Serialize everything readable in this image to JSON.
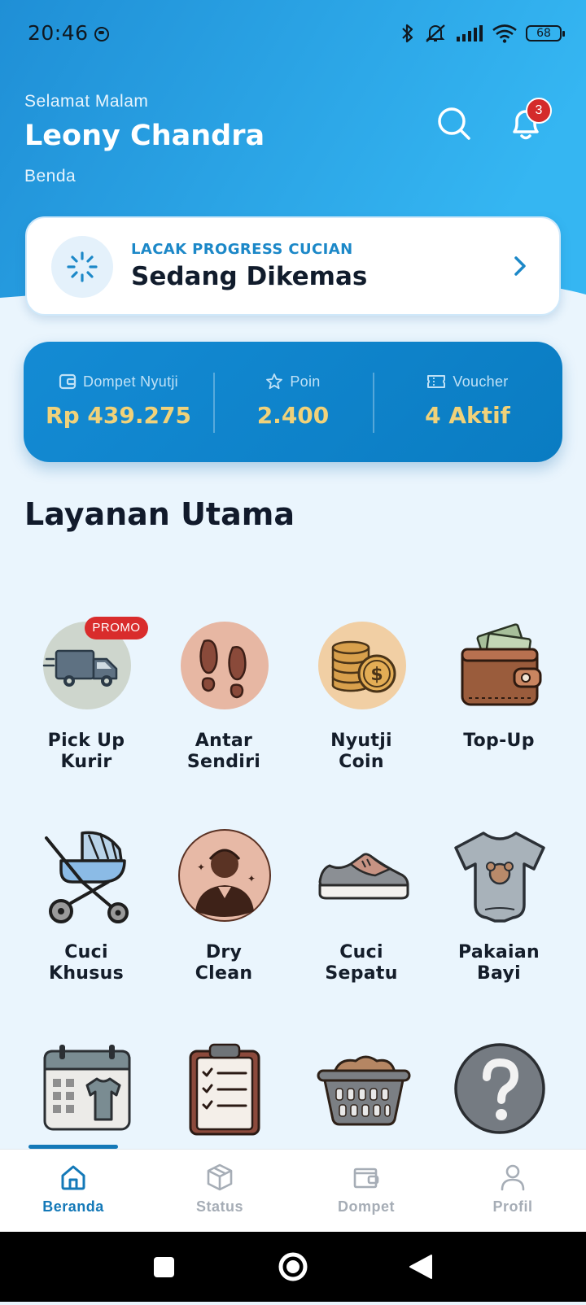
{
  "status_bar": {
    "time": "20:46",
    "battery": "68"
  },
  "header": {
    "greeting": "Selamat Malam",
    "user_name": "Leony Chandra",
    "location": "Benda",
    "notification_count": "3"
  },
  "tracking": {
    "label": "LACAK PROGRESS CUCIAN",
    "status": "Sedang Dikemas"
  },
  "wallet": {
    "items": [
      {
        "label": "Dompet Nyutji",
        "value": "Rp 439.275",
        "icon": "wallet-icon"
      },
      {
        "label": "Poin",
        "value": "2.400",
        "icon": "star-icon"
      },
      {
        "label": "Voucher",
        "value": "4 Aktif",
        "icon": "ticket-icon"
      }
    ]
  },
  "services": {
    "title": "Layanan Utama",
    "promo_badge": "PROMO",
    "items": [
      {
        "label": "Pick Up\nKurir",
        "icon": "delivery-truck-icon"
      },
      {
        "label": "Antar\nSendiri",
        "icon": "footprints-icon"
      },
      {
        "label": "Nyutji\nCoin",
        "icon": "coins-icon"
      },
      {
        "label": "Top-Up",
        "icon": "wallet-icon"
      },
      {
        "label": "Cuci\nKhusus",
        "icon": "baby-stroller-icon"
      },
      {
        "label": "Dry\nClean",
        "icon": "person-icon"
      },
      {
        "label": "Cuci\nSepatu",
        "icon": "sneaker-icon"
      },
      {
        "label": "Pakaian\nBayi",
        "icon": "baby-onesie-icon"
      },
      {
        "label": "",
        "icon": "calendar-shirt-icon"
      },
      {
        "label": "",
        "icon": "clipboard-checklist-icon"
      },
      {
        "label": "",
        "icon": "laundry-basket-icon"
      },
      {
        "label": "",
        "icon": "question-icon"
      }
    ]
  },
  "bottom_nav": {
    "items": [
      {
        "label": "Beranda",
        "icon": "home-icon",
        "active": true
      },
      {
        "label": "Status",
        "icon": "package-icon",
        "active": false
      },
      {
        "label": "Dompet",
        "icon": "wallet-icon",
        "active": false
      },
      {
        "label": "Profil",
        "icon": "user-icon",
        "active": false
      }
    ]
  },
  "colors": {
    "primary": "#1479b8",
    "header_blue": "#2aa3e6",
    "accent_gold": "#f0d27a",
    "badge_red": "#d42b2b"
  }
}
